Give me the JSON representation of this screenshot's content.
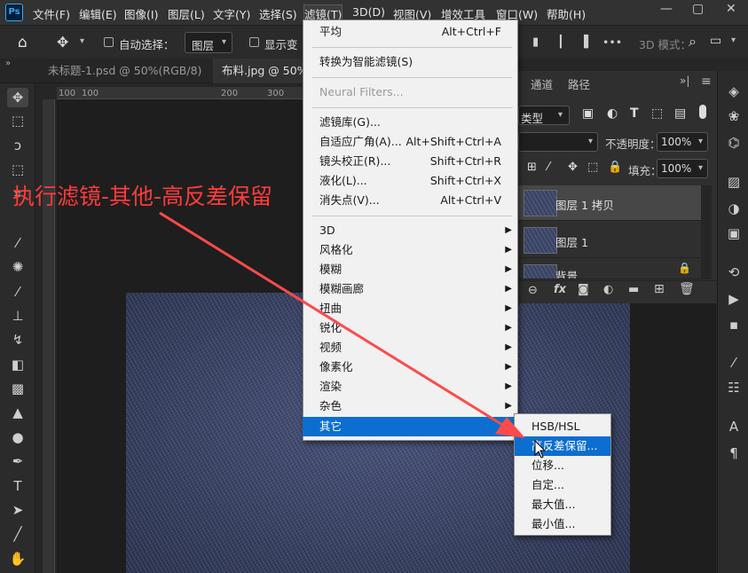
{
  "app": {
    "logo": "Ps"
  },
  "menubar": {
    "items": [
      "文件(F)",
      "编辑(E)",
      "图像(I)",
      "图层(L)",
      "文字(Y)",
      "选择(S)",
      "滤镜(T)",
      "3D(D)",
      "视图(V)",
      "增效工具",
      "窗口(W)",
      "帮助(H)"
    ],
    "active": "滤镜(T)",
    "window_controls": [
      "—",
      "▢",
      "✕"
    ]
  },
  "options_bar": {
    "auto_select_label": "自动选择：",
    "auto_select_value": "图层",
    "show_transform_label": "显示变",
    "more_label": "•••",
    "mode_3d_label": "3D 模式："
  },
  "tabs": [
    {
      "label": "未标题-1.psd @ 50%(RGB/8)",
      "active": false
    },
    {
      "label": "布料.jpg @ 50%",
      "active": true
    }
  ],
  "ruler": {
    "ticks": [
      "100",
      "100",
      "200",
      "300"
    ]
  },
  "filter_menu": {
    "group1": [
      {
        "label": "平均",
        "shortcut": "Alt+Ctrl+F"
      }
    ],
    "group2": [
      {
        "label": "转换为智能滤镜(S)"
      }
    ],
    "group3": [
      {
        "label": "Neural Filters...",
        "disabled": true
      }
    ],
    "group4": [
      {
        "label": "滤镜库(G)...",
        "shortcut": ""
      },
      {
        "label": "自适应广角(A)...",
        "shortcut": "Alt+Shift+Ctrl+A"
      },
      {
        "label": "镜头校正(R)...",
        "shortcut": "Shift+Ctrl+R"
      },
      {
        "label": "液化(L)...",
        "shortcut": "Shift+Ctrl+X"
      },
      {
        "label": "消失点(V)...",
        "shortcut": "Alt+Ctrl+V"
      }
    ],
    "group5": [
      {
        "label": "3D"
      },
      {
        "label": "风格化"
      },
      {
        "label": "模糊"
      },
      {
        "label": "模糊画廊"
      },
      {
        "label": "扭曲"
      },
      {
        "label": "锐化"
      },
      {
        "label": "视频"
      },
      {
        "label": "像素化"
      },
      {
        "label": "渲染"
      },
      {
        "label": "杂色"
      },
      {
        "label": "其它",
        "highlighted": true
      }
    ]
  },
  "submenu_other": {
    "items": [
      {
        "label": "HSB/HSL"
      },
      {
        "label": "高反差保留...",
        "highlighted": true
      },
      {
        "label": "位移..."
      },
      {
        "label": "自定..."
      },
      {
        "label": "最大值..."
      },
      {
        "label": "最小值..."
      }
    ]
  },
  "layers_panel": {
    "tabs": [
      "通道",
      "路径"
    ],
    "kind_label": "类型",
    "opacity_label": "不透明度：",
    "opacity_value": "100%",
    "lock_label": "锁定：",
    "fill_label": "填充：",
    "fill_value": "100%",
    "layers": [
      {
        "name": "图层 1 拷贝",
        "selected": true
      },
      {
        "name": "图层 1",
        "selected": false
      },
      {
        "name": "背景",
        "selected": false
      }
    ],
    "footer_icons": [
      "link-icon",
      "fx-icon",
      "mask-icon",
      "adjustment-icon",
      "folder-icon",
      "new-layer-icon",
      "trash-icon"
    ]
  },
  "annotation": {
    "text": "执行滤镜-其他-高反差保留",
    "color": "#ff3b3b"
  },
  "colors": {
    "menu_highlight": "#0b6ed0",
    "menu_bg": "#f1f1f1",
    "ui_dark": "#2b2b2b"
  }
}
